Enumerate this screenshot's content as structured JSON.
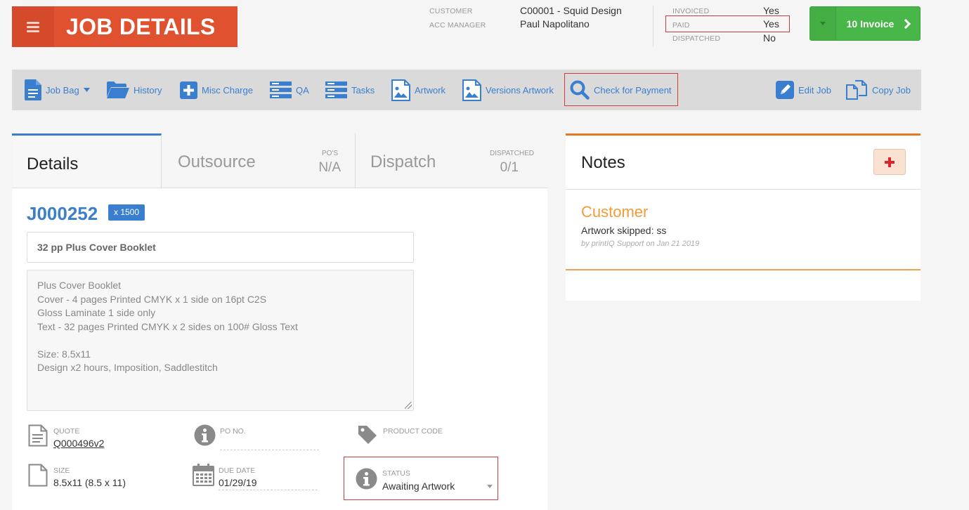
{
  "header": {
    "title": "JOB DETAILS",
    "menu_icon": "hamburger-icon"
  },
  "meta": {
    "customer_label": "CUSTOMER",
    "customer_value": "C00001 - Squid Design",
    "acc_manager_label": "ACC MANAGER",
    "acc_manager_value": "Paul Napolitano",
    "invoiced_label": "INVOICED",
    "invoiced_value": "Yes",
    "paid_label": "PAID",
    "paid_value": "Yes",
    "dispatched_label": "DISPATCHED",
    "dispatched_value": "No"
  },
  "invoice_button": {
    "label": "10 Invoice"
  },
  "toolbar": {
    "job_bag": "Job Bag",
    "history": "History",
    "misc_charge": "Misc Charge",
    "qa": "QA",
    "tasks": "Tasks",
    "artwork": "Artwork",
    "versions_artwork": "Versions Artwork",
    "check_payment": "Check for Payment",
    "edit_job": "Edit Job",
    "copy_job": "Copy Job"
  },
  "tabs": {
    "details": "Details",
    "outsource": "Outsource",
    "pos_label": "PO'S",
    "pos_value": "N/A",
    "dispatch": "Dispatch",
    "dispatched_label": "DISPATCHED",
    "dispatched_value": "0/1"
  },
  "job": {
    "number": "J000252",
    "quantity": "x 1500",
    "title": "32 pp Plus Cover Booklet",
    "description_lines": [
      "Plus Cover Booklet",
      "Cover -  4 pages  Printed CMYK x 1 side  on 16pt C2S",
      "Gloss Laminate 1 side only",
      "Text -  32 pages  Printed CMYK x 2 sides  on 100# Gloss Text",
      "",
      "Size: 8.5x11",
      "Design x2 hours, Imposition, Saddlestitch"
    ]
  },
  "fields": {
    "quote_label": "QUOTE",
    "quote_value": "Q000496v2",
    "po_label": "PO NO.",
    "po_value": "",
    "product_code_label": "PRODUCT CODE",
    "size_label": "SIZE",
    "size_value": "8.5x11 (8.5 x 11)",
    "due_date_label": "DUE DATE",
    "due_date_value": "01/29/19",
    "status_label": "STATUS",
    "status_value": "Awaiting Artwork"
  },
  "notes": {
    "title": "Notes",
    "items": [
      {
        "category": "Customer",
        "text": "Artwork skipped: ss",
        "meta": "by printIQ Support on Jan 21 2019"
      }
    ]
  },
  "colors": {
    "brand_red": "#e0512f",
    "link_blue": "#3a7fcf",
    "invoice_green": "#49b649",
    "notes_orange": "#f39b36",
    "highlight_red": "#d43b3b"
  }
}
